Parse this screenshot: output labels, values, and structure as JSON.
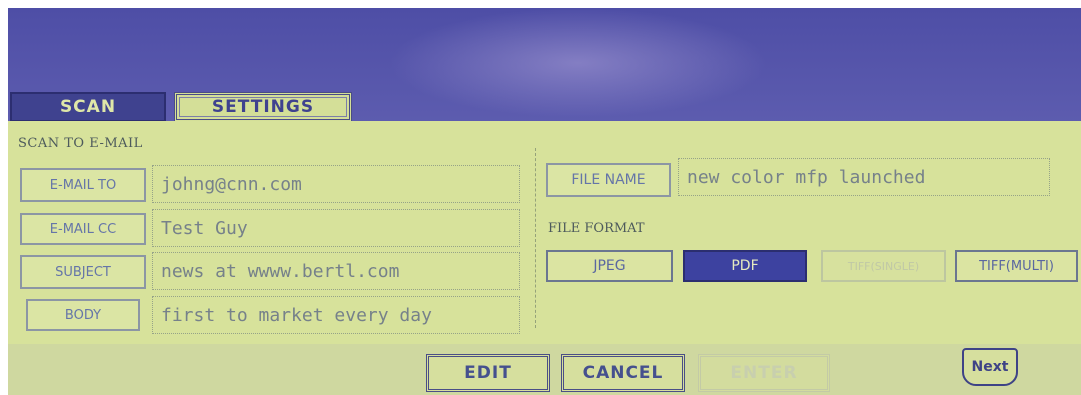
{
  "tabs": {
    "scan": "SCAN",
    "settings": "SETTINGS"
  },
  "section_label": "SCAN TO E-MAIL",
  "email_rows": [
    {
      "button": "E-MAIL TO",
      "value": "johng@cnn.com"
    },
    {
      "button": "E-MAIL CC",
      "value": "Test Guy"
    },
    {
      "button": "SUBJECT",
      "value": "news at wwww.bertl.com"
    },
    {
      "button": "BODY",
      "value": "first to market every day"
    }
  ],
  "file_name": {
    "button": "FILE NAME",
    "value": "new color mfp launched"
  },
  "file_format": {
    "label": "FILE FORMAT",
    "options": [
      {
        "label": "JPEG",
        "state": "normal"
      },
      {
        "label": "PDF",
        "state": "selected"
      },
      {
        "label": "TIFF(SINGLE)",
        "state": "disabled"
      },
      {
        "label": "TIFF(MULTI)",
        "state": "normal"
      }
    ]
  },
  "bottom": {
    "edit": "EDIT",
    "cancel": "CANCEL",
    "enter": "ENTER",
    "next": "Next"
  },
  "colors": {
    "lcd_background": "#d7e29b",
    "selected": "#3d42a0",
    "bezel": "#5b5aae"
  }
}
